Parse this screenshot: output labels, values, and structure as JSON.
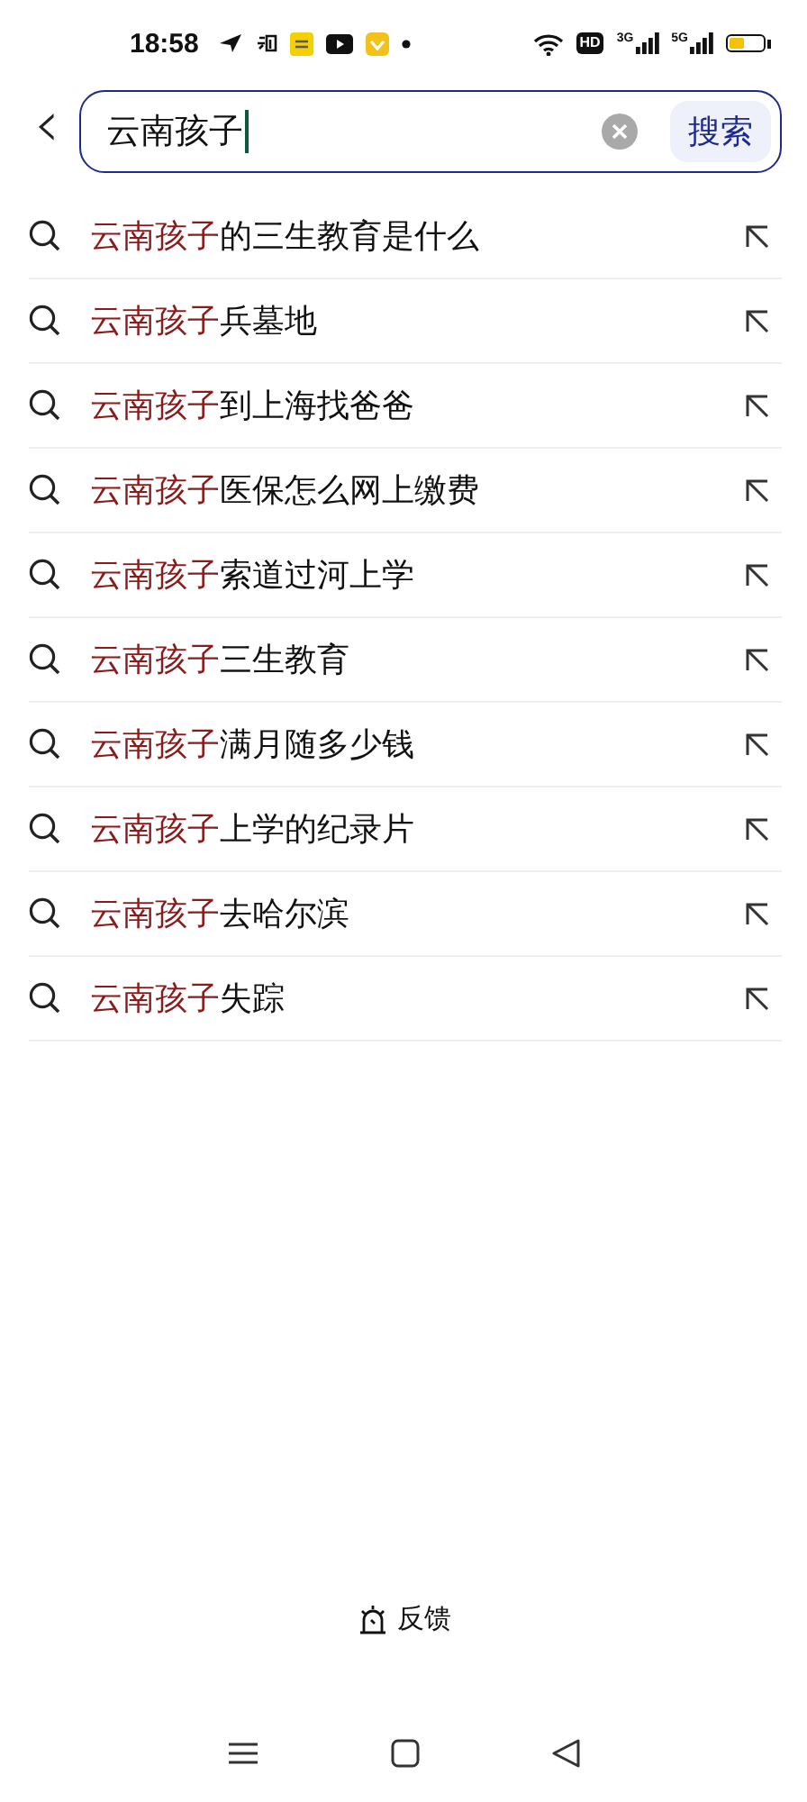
{
  "status_bar": {
    "time": "18:58",
    "hd_label": "HD",
    "network_labels": [
      "3G",
      "5G"
    ]
  },
  "search": {
    "back": "‹",
    "value": "云南孩子",
    "button": "搜索"
  },
  "suggestions": [
    {
      "match": "云南孩子",
      "rest": "的三生教育是什么"
    },
    {
      "match": "云南孩子",
      "rest": "兵墓地"
    },
    {
      "match": "云南孩子",
      "rest": "到上海找爸爸"
    },
    {
      "match": "云南孩子",
      "rest": "医保怎么网上缴费"
    },
    {
      "match": "云南孩子",
      "rest": "索道过河上学"
    },
    {
      "match": "云南孩子",
      "rest": "三生教育"
    },
    {
      "match": "云南孩子",
      "rest": "满月随多少钱"
    },
    {
      "match": "云南孩子",
      "rest": "上学的纪录片"
    },
    {
      "match": "云南孩子",
      "rest": "去哈尔滨"
    },
    {
      "match": "云南孩子",
      "rest": "失踪"
    }
  ],
  "feedback": {
    "label": "反馈"
  }
}
